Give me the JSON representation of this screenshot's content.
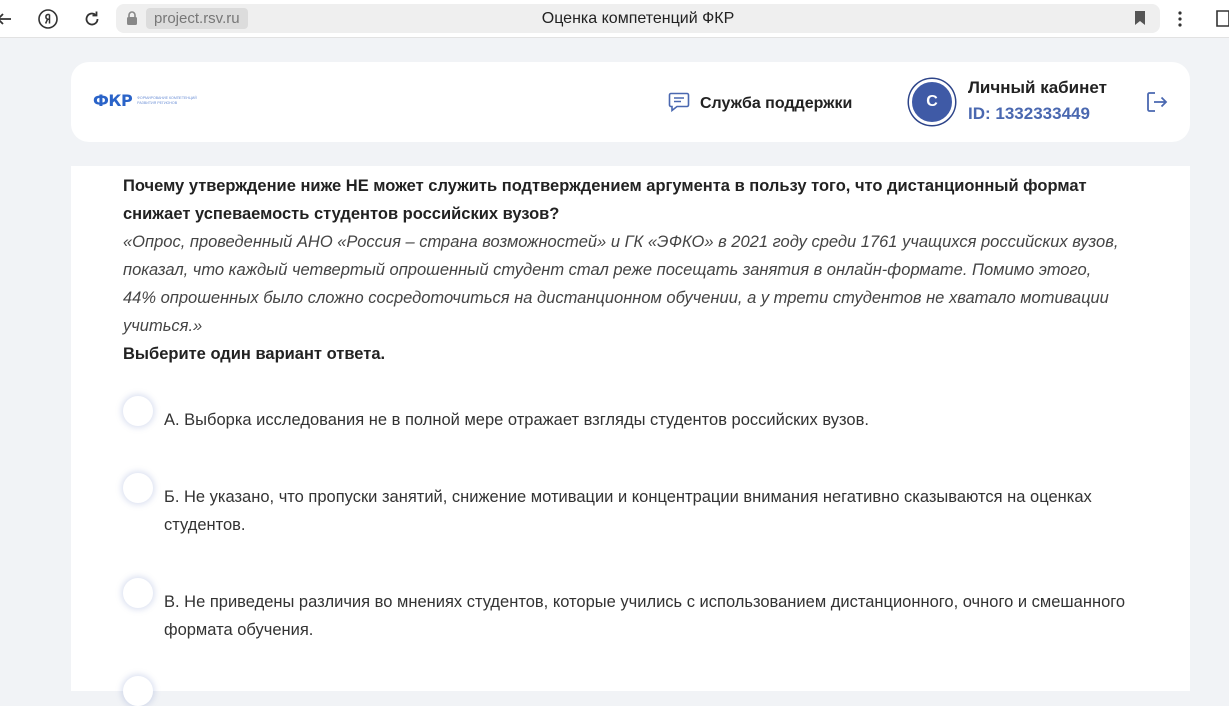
{
  "browser": {
    "url": "project.rsv.ru",
    "tab_title": "Оценка компетенций ФКР"
  },
  "header": {
    "logo_mark": "ФКР",
    "logo_subtitle_line1": "ФОРМИРОВАНИЕ КОМПЕТЕНЦИЙ",
    "logo_subtitle_line2": "РАЗВИТИЯ РЕГИОНОВ",
    "support_label": "Служба поддержки",
    "avatar_letter": "С",
    "cabinet_title": "Личный кабинет",
    "cabinet_id": "ID: 1332333449"
  },
  "question": {
    "title": "Почему утверждение ниже НЕ может служить подтверждением аргумента в пользу того, что дистанционный формат снижает успеваемость студентов российских вузов?",
    "quote": "«Опрос, проведенный АНО «Россия – страна возможностей» и ГК «ЭФКО» в 2021 году среди 1761 учащихся российских вузов, показал, что каждый четвертый опрошенный студент стал реже посещать занятия в онлайн-формате. Помимо этого, 44% опрошенных было сложно сосредоточиться на дистанционном обучении, а у трети студентов не хватало мотивации учиться.»",
    "instruction": "Выберите один вариант ответа."
  },
  "options": [
    {
      "label": "А. Выборка исследования не в полной мере отражает взгляды студентов российских вузов."
    },
    {
      "label": "Б. Не указано, что пропуски занятий, снижение мотивации и концентрации внимания негативно сказываются на оценках студентов."
    },
    {
      "label": "В. Не приведены различия во мнениях студентов, которые учились с использованием дистанционного, очного и смешанного формата обучения."
    },
    {
      "label": ""
    }
  ]
}
